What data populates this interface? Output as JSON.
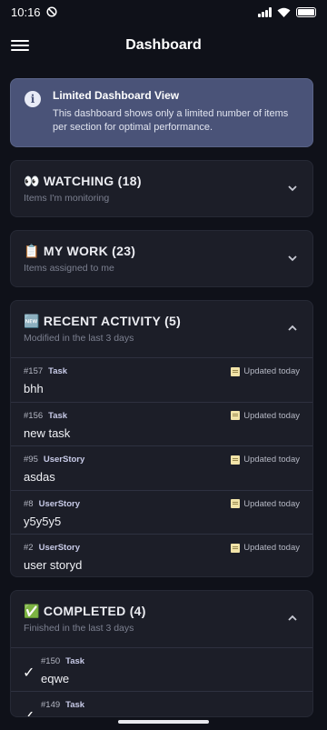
{
  "status_bar": {
    "time": "10:16"
  },
  "app_bar": {
    "title": "Dashboard"
  },
  "info": {
    "title": "Limited Dashboard View",
    "text": "This dashboard shows only a limited number of items per section for optimal performance."
  },
  "sections": {
    "watching": {
      "title": "👀 WATCHING (18)",
      "subtitle": "Items I'm monitoring",
      "expanded": false
    },
    "my_work": {
      "title": "📋 MY WORK (23)",
      "subtitle": "Items assigned to me",
      "expanded": false
    },
    "recent": {
      "title": "🆕 RECENT ACTIVITY (5)",
      "subtitle": "Modified in the last 3 days",
      "expanded": true,
      "items": [
        {
          "id": "#157",
          "type": "Task",
          "title": "bhh",
          "updated": "Updated today"
        },
        {
          "id": "#156",
          "type": "Task",
          "title": "new task",
          "updated": "Updated today"
        },
        {
          "id": "#95",
          "type": "UserStory",
          "title": "asdas",
          "updated": "Updated today"
        },
        {
          "id": "#8",
          "type": "UserStory",
          "title": "y5y5y5",
          "updated": "Updated today"
        },
        {
          "id": "#2",
          "type": "UserStory",
          "title": "user storyd",
          "updated": "Updated today"
        }
      ]
    },
    "completed": {
      "title": "✅ COMPLETED (4)",
      "subtitle": "Finished in the last 3 days",
      "expanded": true,
      "items": [
        {
          "id": "#150",
          "type": "Task",
          "title": "eqwe"
        },
        {
          "id": "#149",
          "type": "Task",
          "title": ""
        }
      ]
    }
  }
}
